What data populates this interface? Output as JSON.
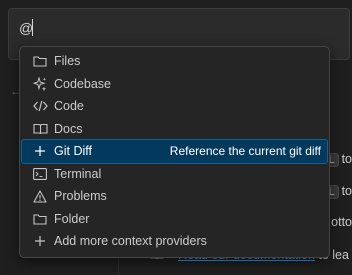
{
  "input": {
    "value": "@"
  },
  "background": {
    "lines": [
      {
        "kbd": "L",
        "text": "to"
      },
      {
        "kbd": "L",
        "text": "to"
      },
      {
        "kbd": "",
        "text": "otto"
      }
    ],
    "docs_link": "Read our documentation",
    "docs_rest": " to lea"
  },
  "menu": {
    "items": [
      {
        "label": "Files",
        "icon": "folder-icon"
      },
      {
        "label": "Codebase",
        "icon": "sparkle-icon"
      },
      {
        "label": "Code",
        "icon": "code-icon"
      },
      {
        "label": "Docs",
        "icon": "book-icon"
      },
      {
        "label": "Git Diff",
        "icon": "plus-icon",
        "description": "Reference the current git diff",
        "active": true
      },
      {
        "label": "Terminal",
        "icon": "terminal-icon"
      },
      {
        "label": "Problems",
        "icon": "warning-icon"
      },
      {
        "label": "Folder",
        "icon": "folder-icon"
      },
      {
        "label": "Add more context providers",
        "icon": "plus-icon"
      }
    ]
  },
  "colors": {
    "background": "#1f1f1f",
    "menu_bg": "#252526",
    "active_bg": "#04395e",
    "link": "#3794ff"
  }
}
